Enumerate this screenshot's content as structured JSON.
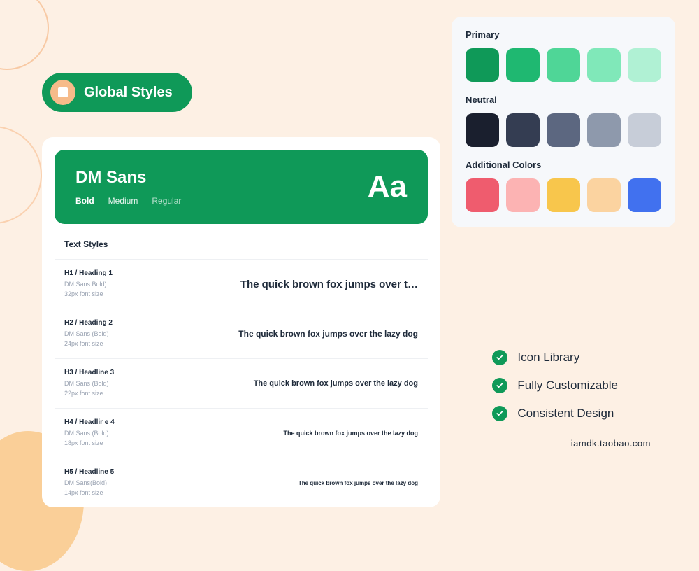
{
  "badge": {
    "label": "Global Styles"
  },
  "font": {
    "name": "DM Sans",
    "weights": {
      "bold": "Bold",
      "medium": "Medium",
      "regular": "Regular"
    },
    "specimen": "Aa"
  },
  "text_styles_title": "Text Styles",
  "styles": [
    {
      "label": "H1 / Heading 1",
      "meta1": "DM Sans Bold)",
      "meta2": "32px font size",
      "sample": "The quick brown fox jumps over t…"
    },
    {
      "label": "H2 / Heading 2",
      "meta1": "DM Sans (Bold)",
      "meta2": "24px font size",
      "sample": "The quick brown fox jumps over the lazy dog"
    },
    {
      "label": "H3 / Headline 3",
      "meta1": "DM Sans (Bold)",
      "meta2": "22px font size",
      "sample": "The quick brown fox jumps over the lazy dog"
    },
    {
      "label": "H4 / Headlir e 4",
      "meta1": "DM Sans (Bold)",
      "meta2": "18px font size",
      "sample": "The quick brown fox jumps over the lazy dog"
    },
    {
      "label": "H5 / Headline 5",
      "meta1": "DM Sans(Bold)",
      "meta2": "14px font size",
      "sample": "The quick brown fox jumps over the lazy dog"
    }
  ],
  "palettes": {
    "primary": {
      "title": "Primary",
      "colors": [
        "#0f9958",
        "#1fb871",
        "#4fd697",
        "#80e8b9",
        "#b0f1d4"
      ]
    },
    "neutral": {
      "title": "Neutral",
      "colors": [
        "#1a1f2e",
        "#343d52",
        "#5c6780",
        "#8e99ac",
        "#c7cdd8"
      ]
    },
    "additional": {
      "title": "Additional Colors",
      "colors": [
        "#ef5c6e",
        "#fcb3b3",
        "#f8c64c",
        "#fbd3a0",
        "#4171ef"
      ]
    }
  },
  "features": [
    "Icon Library",
    "Fully Customizable",
    "Consistent Design"
  ],
  "watermark": "iamdk.taobao.com"
}
